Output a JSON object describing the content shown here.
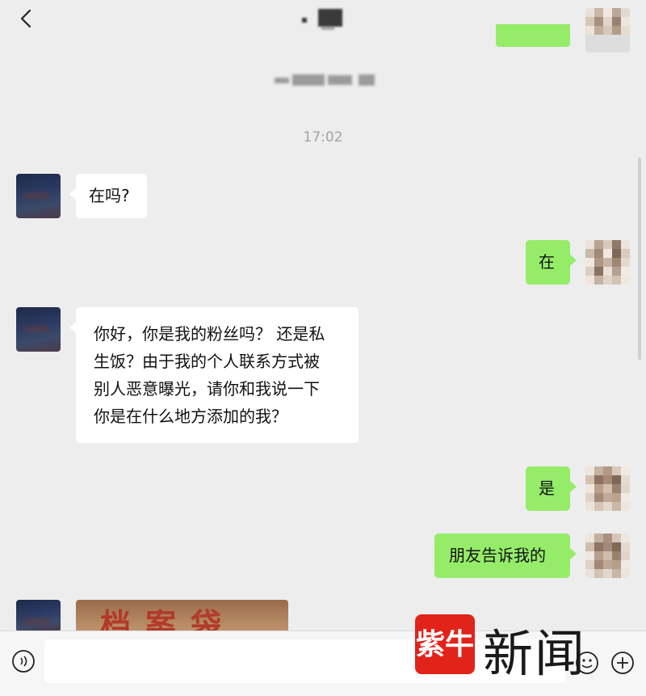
{
  "header": {
    "back_label": "‹"
  },
  "chat": {
    "time": "17:02",
    "messages": [
      {
        "side": "left",
        "text": "在吗?"
      },
      {
        "side": "right",
        "text": "在"
      },
      {
        "side": "left",
        "lines": [
          "你好，你是我的粉丝吗？ 还是私",
          "生饭？由于我的个人联系方式被",
          "别人恶意曝光，请你和我说一下",
          "你是在什么地方添加的我？"
        ]
      },
      {
        "side": "right",
        "text": "是"
      },
      {
        "side": "right",
        "text": "朋友告诉我的"
      }
    ],
    "image_message_text": "档案袋"
  },
  "watermark": {
    "logo_text": "紫牛",
    "text": "新闻"
  },
  "colors": {
    "background": "#ededed",
    "bubble_right": "#95ec69",
    "bubble_left": "#ffffff",
    "watermark_red": "#e2231a"
  },
  "icons": {
    "back": "chevron-left-icon",
    "voice": "voice-icon",
    "emoji": "emoji-icon",
    "plus": "plus-icon",
    "more": "more-icon"
  }
}
